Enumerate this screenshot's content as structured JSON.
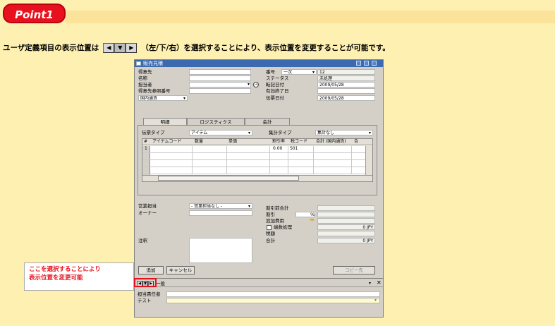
{
  "point_label": "Point1",
  "description": {
    "before": "ユーザ定義項目の表示位置は",
    "nav_symbols": [
      "◀",
      "▼",
      "▶"
    ],
    "after": "（左/下/右）を選択することにより、表示位置を変更することが可能です。"
  },
  "window": {
    "title": "販売見積",
    "left_fields": [
      {
        "label": "得意先",
        "value": ""
      },
      {
        "label": "名称",
        "value": ""
      },
      {
        "label": "担当者",
        "value": ""
      },
      {
        "label": "得意先参照番号",
        "value": ""
      },
      {
        "label": "国内通貨",
        "value": ""
      }
    ],
    "right_fields": [
      {
        "label": "番号",
        "value": "一次",
        "value2": "12"
      },
      {
        "label": "ステータス",
        "value": "",
        "value2": "未処理"
      },
      {
        "label": "転記日付",
        "value": "",
        "value2": "2009/05/28"
      },
      {
        "label": "有効終了日",
        "value": "",
        "value2": ""
      },
      {
        "label": "伝票日付",
        "value": "",
        "value2": "2009/05/28"
      }
    ],
    "tabs": [
      "明細",
      "ロジスティクス",
      "会計"
    ],
    "item_type_label": "伝票タイプ",
    "item_type_value": "アイテム",
    "summary_type_label": "集計タイプ",
    "summary_type_value": "集計なし",
    "columns": [
      "#",
      "アイテムコード",
      "数量",
      "単価",
      "割引率",
      "税コード",
      "合計 (国内通貨)",
      "合"
    ],
    "first_row": {
      "num": "1",
      "discount": "0.00",
      "tax": "S01"
    },
    "sales_rep_label": "営業担当",
    "sales_rep_value": "- 営業担当なし -",
    "owner_label": "オーナー",
    "remarks_label": "注釈",
    "totals": [
      {
        "label": "割引前合計",
        "value": ""
      },
      {
        "label": "割引",
        "value": "%"
      },
      {
        "label": "追加費用",
        "value": ""
      },
      {
        "label": "端数処理",
        "value": "0 JPY"
      },
      {
        "label": "税額",
        "value": ""
      },
      {
        "label": "合計",
        "value": "0 JPY"
      }
    ],
    "add_button": "追加",
    "cancel_button": "キャンセル",
    "copy_button": "コピー先"
  },
  "callout": {
    "line1": "ここを選択することにより",
    "line2": "表示位置を変更可能"
  },
  "udf_panel": {
    "title": "一般",
    "fields": [
      {
        "label": "担当責任者",
        "value": ""
      },
      {
        "label": "テスト",
        "value": ""
      }
    ]
  },
  "colors": {
    "point_red": "#e8101c",
    "background": "#fdf0b0",
    "titlebar": "#3c6ab0"
  }
}
